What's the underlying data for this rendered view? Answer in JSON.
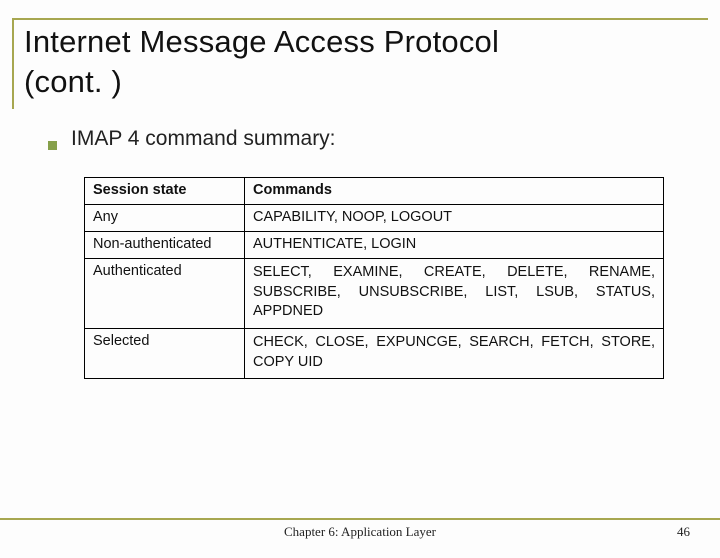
{
  "title_line1": "Internet Message Access Protocol",
  "title_line2": "(cont. )",
  "bullet_text": "IMAP 4 command summary:",
  "table": {
    "head": {
      "state": "Session state",
      "commands": "Commands"
    },
    "rows": [
      {
        "state": "Any",
        "commands": "CAPABILITY, NOOP, LOGOUT"
      },
      {
        "state": "Non-authenticated",
        "commands": "AUTHENTICATE, LOGIN"
      },
      {
        "state": "Authenticated",
        "commands": "SELECT, EXAMINE, CREATE, DELETE, RENAME, SUBSCRIBE, UNSUBSCRIBE, LIST, LSUB, STATUS, APPDNED"
      },
      {
        "state": "Selected",
        "commands": "CHECK, CLOSE, EXPUNCGE, SEARCH, FETCH, STORE, COPY UID"
      }
    ]
  },
  "footer": {
    "center": "Chapter 6: Application Layer",
    "page": "46"
  }
}
